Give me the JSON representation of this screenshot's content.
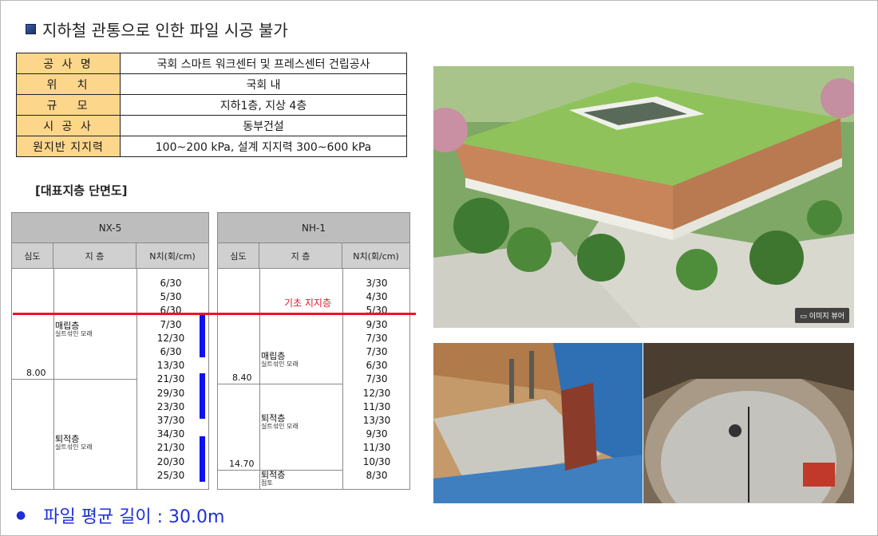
{
  "title": "지하철 관통으로 인한 파일 시공 불가",
  "info_table": [
    {
      "key": "공 사 명",
      "value": "국회 스마트 워크센터 및 프레스센터 건립공사"
    },
    {
      "key": "위   치",
      "value": "국회 내"
    },
    {
      "key": "규   모",
      "value": "지하1층, 지상 4층"
    },
    {
      "key": "시 공 사",
      "value": "동부건설"
    },
    {
      "key": "원지반 지지력",
      "value": "100~200 kPa, 설계 지지력 300~600 kPa"
    }
  ],
  "section_title": "[대표지층 단면도]",
  "bearing_layer_label": "기초 지지층",
  "logs": [
    {
      "name": "NX-5",
      "headers": [
        "심도",
        "지 층",
        "N치(회/cm)"
      ],
      "depth_mark": "8.00",
      "layers": [
        {
          "name": "매립층",
          "desc": "실트섞인 모래"
        },
        {
          "name": "퇴적층",
          "desc": "실트섞인 모래"
        }
      ],
      "n_values": [
        "6/30",
        "5/30",
        "6/30",
        "7/30",
        "12/30",
        "6/30",
        "13/30",
        "21/30",
        "29/30",
        "23/30",
        "37/30",
        "34/30",
        "21/30",
        "20/30",
        "25/30"
      ]
    },
    {
      "name": "NH-1",
      "headers": [
        "심도",
        "지 층",
        "N치(회/cm)"
      ],
      "depth_marks": [
        "8.40",
        "14.70"
      ],
      "layers": [
        {
          "name": "매립층",
          "desc": "실트섞인 모래"
        },
        {
          "name": "퇴적층",
          "desc": "실트섞인 모래"
        },
        {
          "name": "퇴적층",
          "desc": "점토"
        }
      ],
      "n_values": [
        "3/30",
        "4/30",
        "5/30",
        "9/30",
        "7/30",
        "7/30",
        "6/30",
        "7/30",
        "12/30",
        "11/30",
        "13/30",
        "9/30",
        "11/30",
        "10/30",
        "8/30"
      ]
    }
  ],
  "photo_badge": "이미지 뷰어",
  "note": "파일 평균 길이 : 30.0m",
  "colors": {
    "key_cell": "#fcd68b",
    "blue_bar": "#1010f0",
    "red_line": "#e8152a",
    "note_text": "#1e2fd8"
  }
}
